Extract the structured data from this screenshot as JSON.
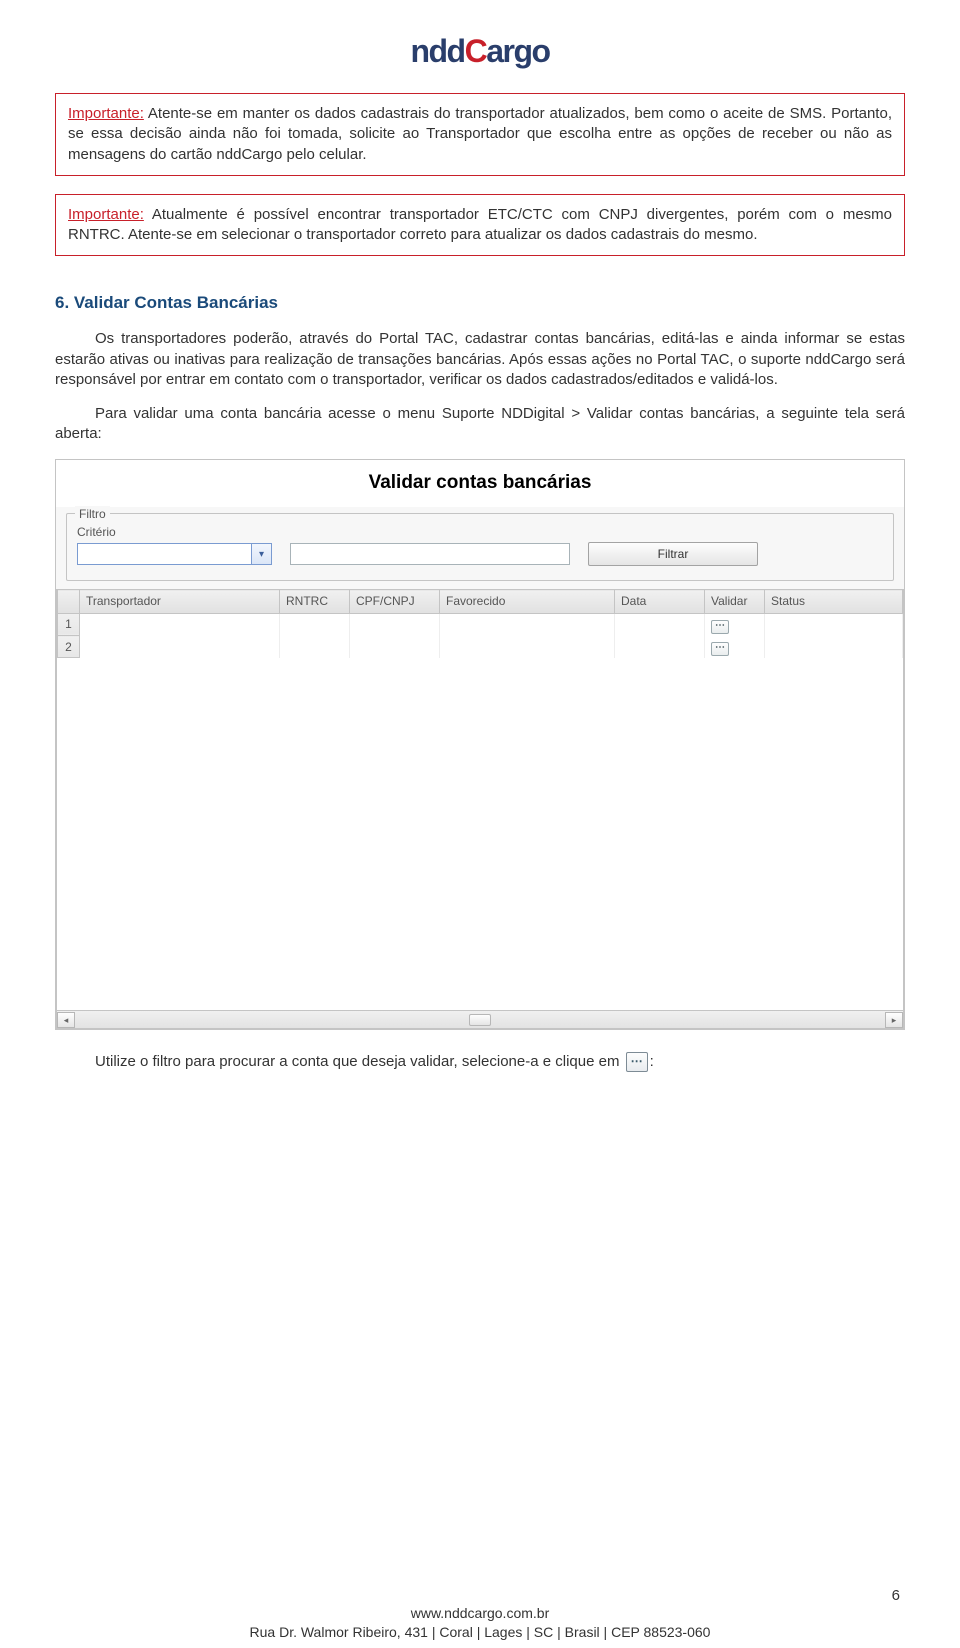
{
  "logo": {
    "part1": "ndd",
    "part2": "C",
    "part3": "argo"
  },
  "importantBoxes": [
    {
      "label": "Importante:",
      "text": " Atente-se em manter os dados cadastrais do transportador atualizados, bem como o aceite de SMS. Portanto, se essa decisão ainda não foi tomada, solicite ao Transportador que escolha entre as opções de receber ou não as mensagens do cartão nddCargo pelo celular."
    },
    {
      "label": "Importante:",
      "text": " Atualmente é possível encontrar transportador ETC/CTC com CNPJ divergentes, porém com o mesmo RNTRC. Atente-se em selecionar o transportador correto para atualizar os dados cadastrais do mesmo."
    }
  ],
  "sectionHeading": "6. Validar Contas Bancárias",
  "paragraphs": [
    "Os transportadores poderão, através do Portal TAC, cadastrar contas bancárias, editá-las e ainda informar se estas estarão ativas ou inativas para realização de transações bancárias. Após essas ações no Portal TAC, o suporte nddCargo será responsável por entrar em contato com o transportador, verificar os dados cadastrados/editados e validá-los.",
    "Para validar uma conta bancária acesse o menu Suporte NDDigital > Validar contas bancárias, a seguinte tela será aberta:"
  ],
  "appUI": {
    "title": "Validar contas bancárias",
    "fieldsetLegend": "Filtro",
    "criterioLabel": "Critério",
    "filtrarBtn": "Filtrar",
    "columns": [
      "",
      "Transportador",
      "RNTRC",
      "CPF/CNPJ",
      "Favorecido",
      "Data",
      "Validar",
      "Status"
    ],
    "rows": [
      {
        "num": "1"
      },
      {
        "num": "2"
      }
    ]
  },
  "afterUIText": "Utilize o filtro para procurar a conta que deseja validar, selecione-a e clique em ",
  "afterUITrail": ":",
  "pageNum": "6",
  "footer": {
    "url": "www.nddcargo.com.br",
    "addr": "Rua Dr. Walmor Ribeiro, 431 | Coral | Lages | SC | Brasil | CEP 88523-060"
  }
}
